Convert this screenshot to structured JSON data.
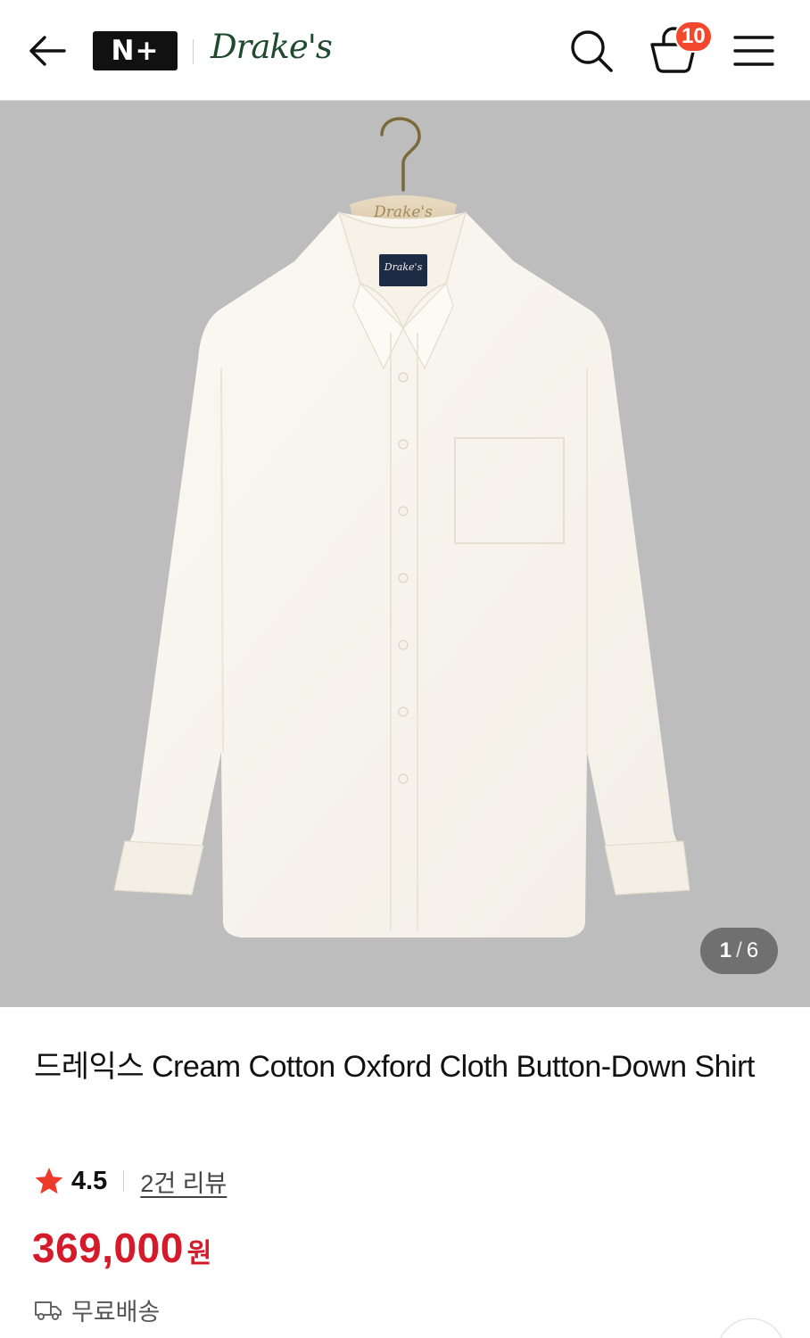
{
  "header": {
    "back_icon": "arrow-left-icon",
    "nplus_logo_text": "N+",
    "brand_logo_text": "Drake's",
    "search_icon": "search-icon",
    "cart_icon": "shopping-bag-icon",
    "cart_count": "10",
    "menu_icon": "hamburger-menu-icon",
    "badge_color": "#f2482d"
  },
  "gallery": {
    "current": "1",
    "separator": "/",
    "total": "6",
    "hanger_text": "Drake's",
    "label_text": "Drake's",
    "background_color": "#bdbdbd"
  },
  "product": {
    "title": "드레익스 Cream Cotton Oxford Cloth Button-Down Shirt",
    "rating": "4.5",
    "review_link": "2건 리뷰",
    "price": "369,000",
    "currency": "원",
    "shipping": "무료배송",
    "price_color": "#d51a2a",
    "star_color": "#ee3a2a"
  }
}
